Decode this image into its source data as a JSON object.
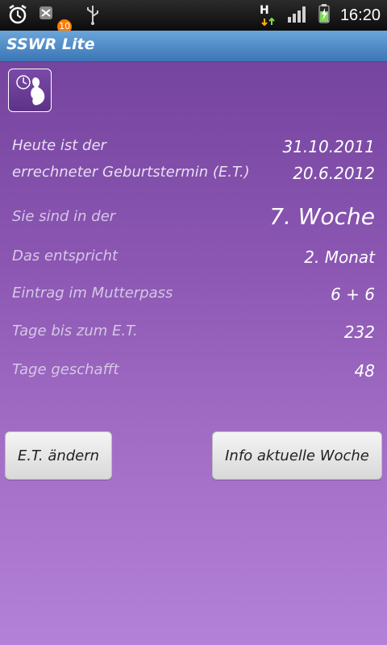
{
  "status_bar": {
    "notifications": [
      {
        "icon": "alarm-clock-icon"
      },
      {
        "icon": "missed-updates-icon",
        "badge": "10"
      },
      {
        "icon": "usb-icon"
      }
    ],
    "network_type": "H",
    "time": "16:20"
  },
  "app": {
    "title": "SSWR Lite"
  },
  "content": {
    "today_label": "Heute ist der",
    "today_value": "31.10.2011",
    "due_label": "errechneter Geburtstermin (E.T.)",
    "due_value": "20.6.2012",
    "week_label": "Sie sind in der",
    "week_value": "7. Woche",
    "month_label": "Das entspricht",
    "month_value": "2. Monat",
    "pass_label": "Eintrag im Mutterpass",
    "pass_value": "6 + 6",
    "days_left_label": "Tage bis zum E.T.",
    "days_left_value": "232",
    "days_done_label": "Tage geschafft",
    "days_done_value": "48"
  },
  "buttons": {
    "change_et": "E.T. ändern",
    "info_week": "Info aktuelle Woche"
  }
}
